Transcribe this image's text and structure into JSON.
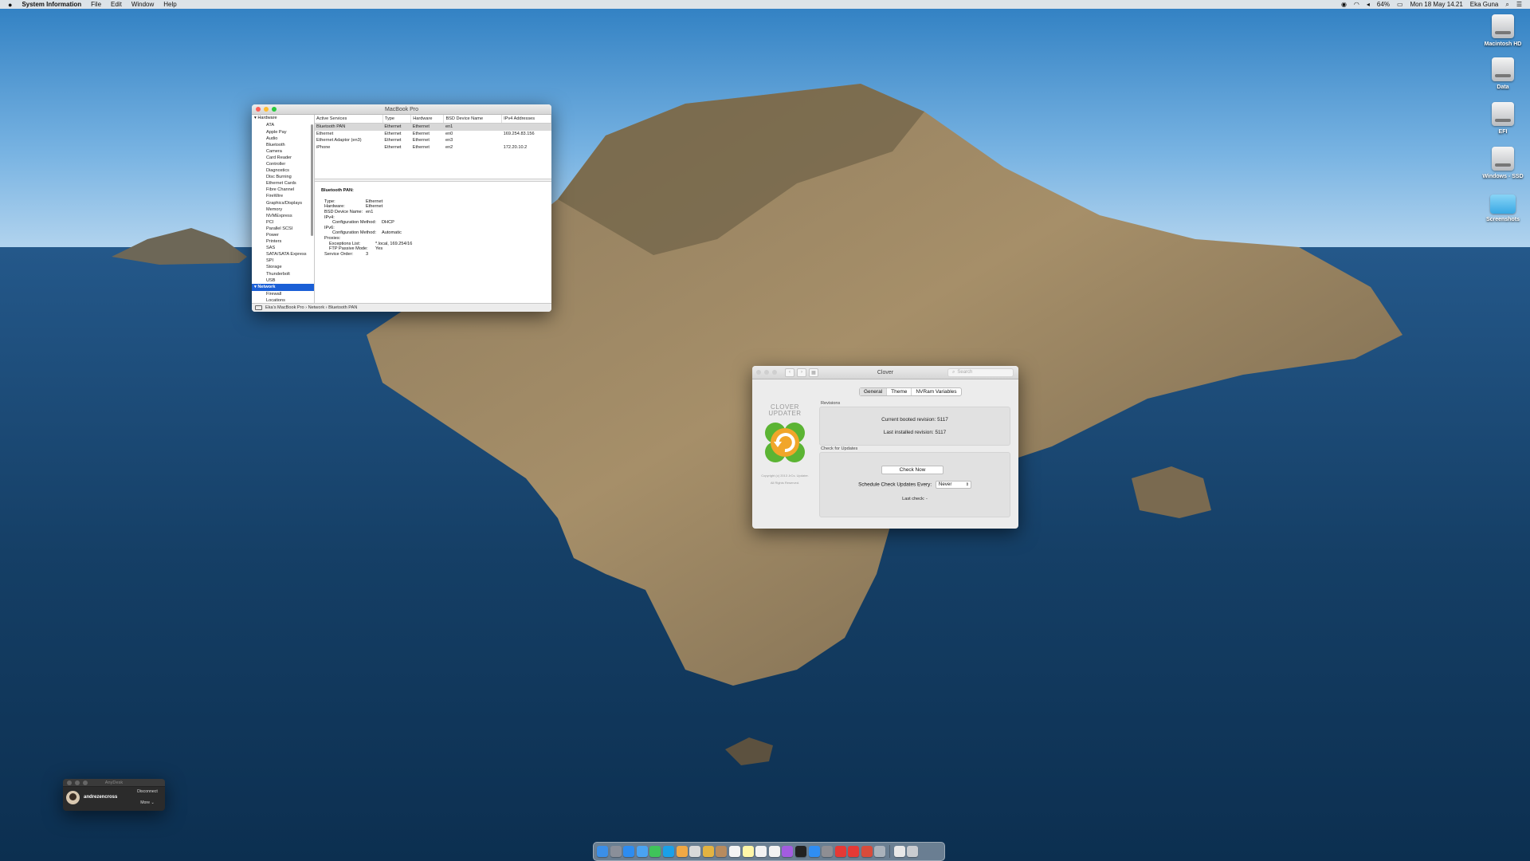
{
  "menubar": {
    "app_name": "System Information",
    "menus": [
      "File",
      "Edit",
      "Window",
      "Help"
    ],
    "battery": "64%",
    "datetime": "Mon 18 May 14.21",
    "user": "Eka Guna"
  },
  "desktop_icons": [
    "Macintosh HD",
    "Data",
    "EFI",
    "Windows - SSD",
    "Screenshots"
  ],
  "sysinfo": {
    "title": "MacBook Pro",
    "sidebar": {
      "hardware_label": "Hardware",
      "hardware_items": [
        "ATA",
        "Apple Pay",
        "Audio",
        "Bluetooth",
        "Camera",
        "Card Reader",
        "Controller",
        "Diagnostics",
        "Disc Burning",
        "Ethernet Cards",
        "Fibre Channel",
        "FireWire",
        "Graphics/Displays",
        "Memory",
        "NVMExpress",
        "PCI",
        "Parallel SCSI",
        "Power",
        "Printers",
        "SAS",
        "SATA/SATA Express",
        "SPI",
        "Storage",
        "Thunderbolt",
        "USB"
      ],
      "network_label": "Network",
      "network_items": [
        "Firewall",
        "Locations",
        "Volumes"
      ]
    },
    "table": {
      "headers": [
        "Active Services",
        "Type",
        "Hardware",
        "BSD Device Name",
        "IPv4 Addresses"
      ],
      "rows": [
        [
          "Bluetooth PAN",
          "Ethernet",
          "Ethernet",
          "en1",
          ""
        ],
        [
          "Ethernet",
          "Ethernet",
          "Ethernet",
          "en0",
          "169.254.83.156"
        ],
        [
          "Ethernet Adaptor (en3)",
          "Ethernet",
          "Ethernet",
          "en3",
          ""
        ],
        [
          "iPhone",
          "Ethernet",
          "Ethernet",
          "en2",
          "172.20.10.2"
        ]
      ]
    },
    "detail": {
      "heading": "Bluetooth PAN:",
      "fields": [
        {
          "k": "Type:",
          "v": "Ethernet",
          "level": 0
        },
        {
          "k": "Hardware:",
          "v": "Ethernet",
          "level": 0
        },
        {
          "k": "BSD Device Name:",
          "v": "en1",
          "level": 0
        },
        {
          "k": "IPv4:",
          "v": "",
          "level": 0
        },
        {
          "k": "Configuration Method:",
          "v": "DHCP",
          "level": 1
        },
        {
          "k": "IPv6:",
          "v": "",
          "level": 0
        },
        {
          "k": "Configuration Method:",
          "v": "Automatic",
          "level": 1
        },
        {
          "k": "Proxies:",
          "v": "",
          "level": 0
        },
        {
          "k": "Exceptions List:",
          "v": "*.local, 169.254/16",
          "level": 2
        },
        {
          "k": "FTP Passive Mode:",
          "v": "Yes",
          "level": 2
        },
        {
          "k": "Service Order:",
          "v": "3",
          "level": 0
        }
      ]
    },
    "statusbar": "Eka's MacBook Pro › Network › Bluetooth PAN"
  },
  "clover": {
    "title": "Clover",
    "search_placeholder": "Search",
    "tabs": [
      "General",
      "Theme",
      "NVRam Variables"
    ],
    "active_tab": "General",
    "logo_line1": "CLOVER",
    "logo_line2": "UPDATER",
    "copyright_line1": "Copyright (c) 2013 JrCs. Updater.",
    "copyright_line2": "All Rights Reserved.",
    "revisions_label": "Revisions",
    "current_booted": "Current booted revision:  5117",
    "last_installed": "Last installed revision:  5117",
    "check_label": "Check for Updates",
    "check_now": "Check Now",
    "schedule_label": "Schedule Check Updates Every:",
    "schedule_value": "Never",
    "last_check": "Last check: -"
  },
  "anydesk": {
    "title": "AnyDesk",
    "user": "andrezencross",
    "disconnect": "Disconnect",
    "more": "More"
  },
  "dock": {
    "apps": [
      {
        "name": "finder-app",
        "color": "#3b8fe8"
      },
      {
        "name": "launchpad-app",
        "color": "#8a8f99"
      },
      {
        "name": "safari-app",
        "color": "#2d8cf0"
      },
      {
        "name": "mail-app",
        "color": "#4aa3f2"
      },
      {
        "name": "messages-app",
        "color": "#3fc35a"
      },
      {
        "name": "skype-app",
        "color": "#1aa0e8"
      },
      {
        "name": "photos-app",
        "color": "#f0a844"
      },
      {
        "name": "preview-app",
        "color": "#d9d9d9"
      },
      {
        "name": "chrome-app",
        "color": "#e3b341"
      },
      {
        "name": "contacts-app",
        "color": "#b78b5e"
      },
      {
        "name": "calendar-app",
        "color": "#f4f4f4"
      },
      {
        "name": "notes-app",
        "color": "#fff6a8"
      },
      {
        "name": "reminders-app",
        "color": "#f2f2f2"
      },
      {
        "name": "music-app",
        "color": "#f2f2f2"
      },
      {
        "name": "podcasts-app",
        "color": "#a35ce0"
      },
      {
        "name": "tv-app",
        "color": "#222222"
      },
      {
        "name": "appstore-app",
        "color": "#2f8ef4"
      },
      {
        "name": "system-preferences-app",
        "color": "#8e8e93"
      },
      {
        "name": "anydesk-app",
        "color": "#e53935"
      },
      {
        "name": "anydesk-app-2",
        "color": "#e53935"
      },
      {
        "name": "system-information-app",
        "color": "#d84b3b"
      },
      {
        "name": "clover-app",
        "color": "#aab2bb"
      }
    ],
    "trailing": [
      {
        "name": "documents-stack",
        "color": "#e8e8e8"
      },
      {
        "name": "trash-icon",
        "color": "#c9ccd0"
      }
    ]
  }
}
